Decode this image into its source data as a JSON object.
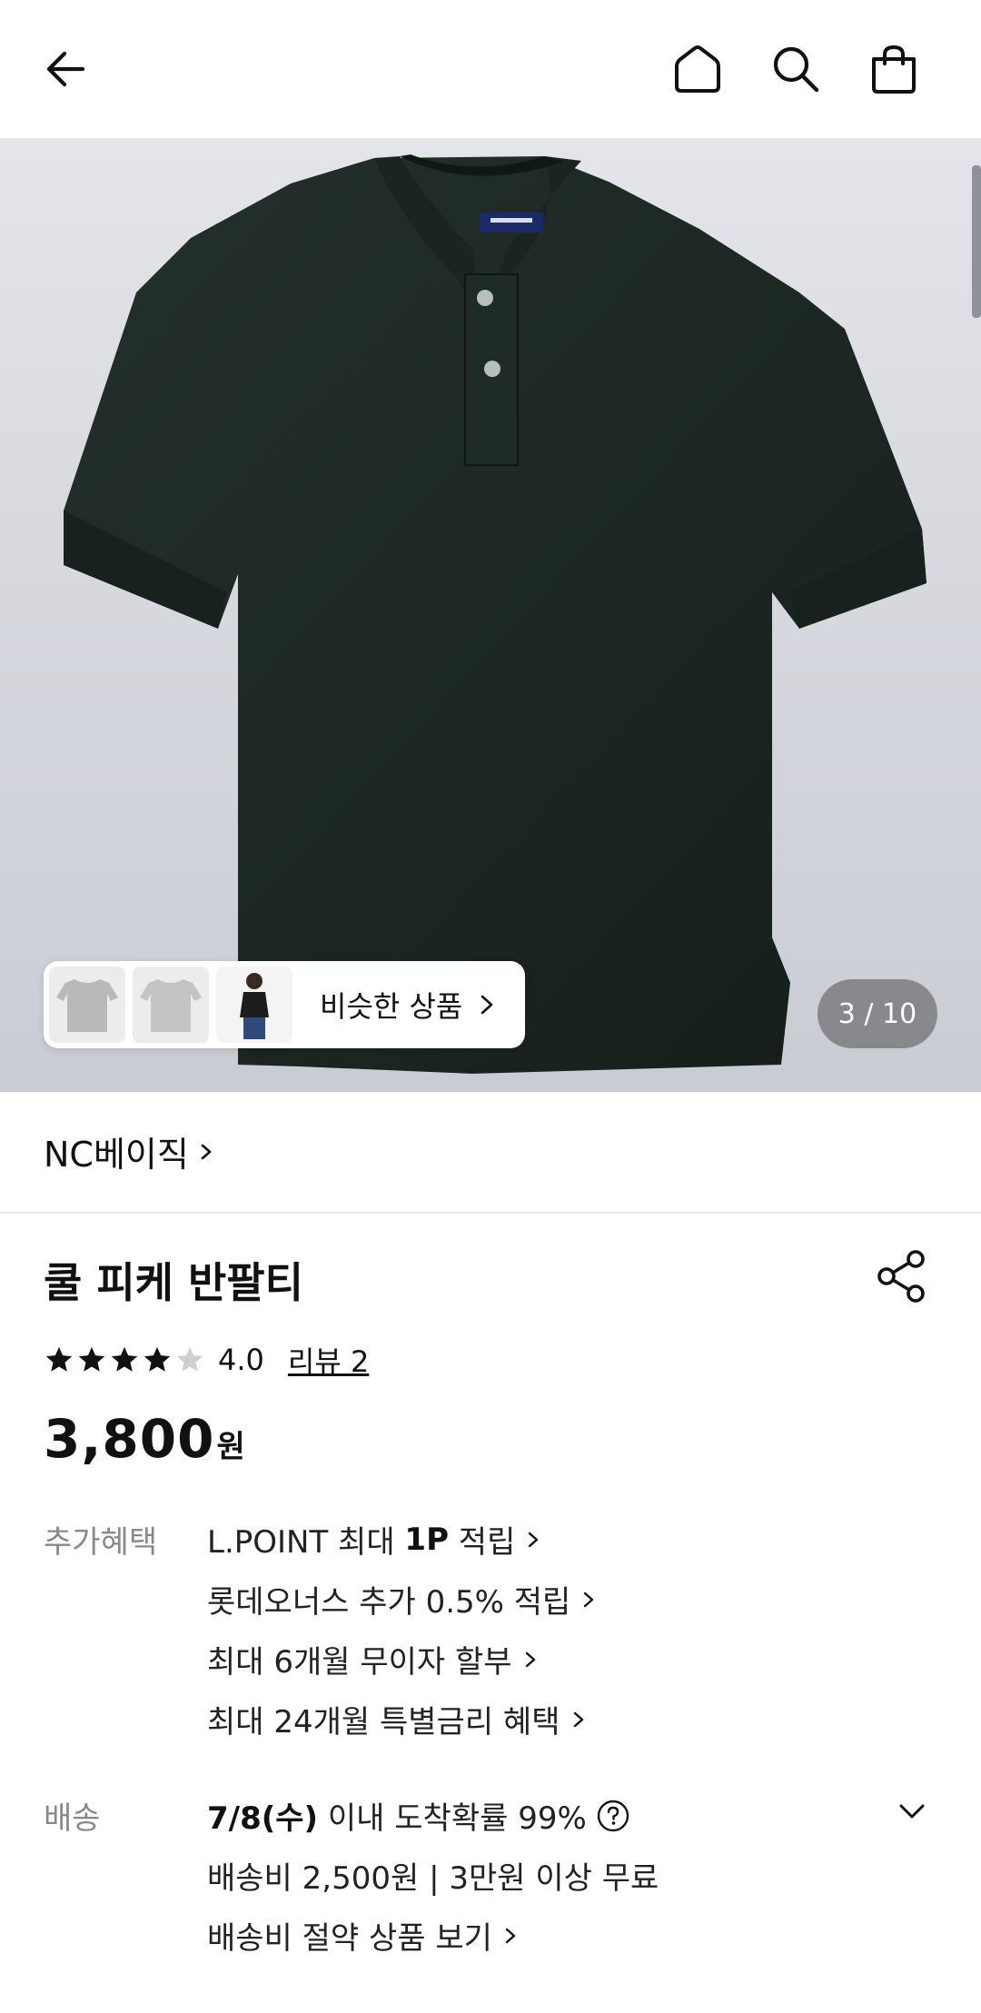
{
  "header": {
    "back_icon": "arrow-left-icon",
    "home_icon": "home-icon",
    "search_icon": "search-icon",
    "cart_icon": "shopping-bag-icon"
  },
  "gallery": {
    "counter": "3 / 10",
    "similar_label": "비슷한 상품"
  },
  "brand": {
    "name": "NC베이직"
  },
  "product": {
    "title": "쿨 피케 반팔티",
    "rating": 4.0,
    "rating_text": "4.0",
    "review_link": "리뷰 2",
    "price": "3,800",
    "currency": "원"
  },
  "benefits": {
    "label": "추가혜택",
    "lpoint_prefix": "L.POINT 최대 ",
    "lpoint_bold": "1P",
    "lpoint_suffix": " 적립",
    "lotte_members": "롯데오너스 추가 0.5% 적립",
    "installment": "최대 6개월 무이자 할부",
    "special_rate": "최대 24개월 특별금리 혜택"
  },
  "shipping": {
    "label": "배송",
    "date_bold": "7/8(수)",
    "date_rest": " 이내 도착확률 99%",
    "fee": "배송비 2,500원 | 3만원 이상 무료",
    "save_link": "배송비 절약 상품 보기"
  },
  "colors": {
    "shirt": "#1e2a26",
    "accent_text": "#111111",
    "muted_text": "#888888"
  }
}
